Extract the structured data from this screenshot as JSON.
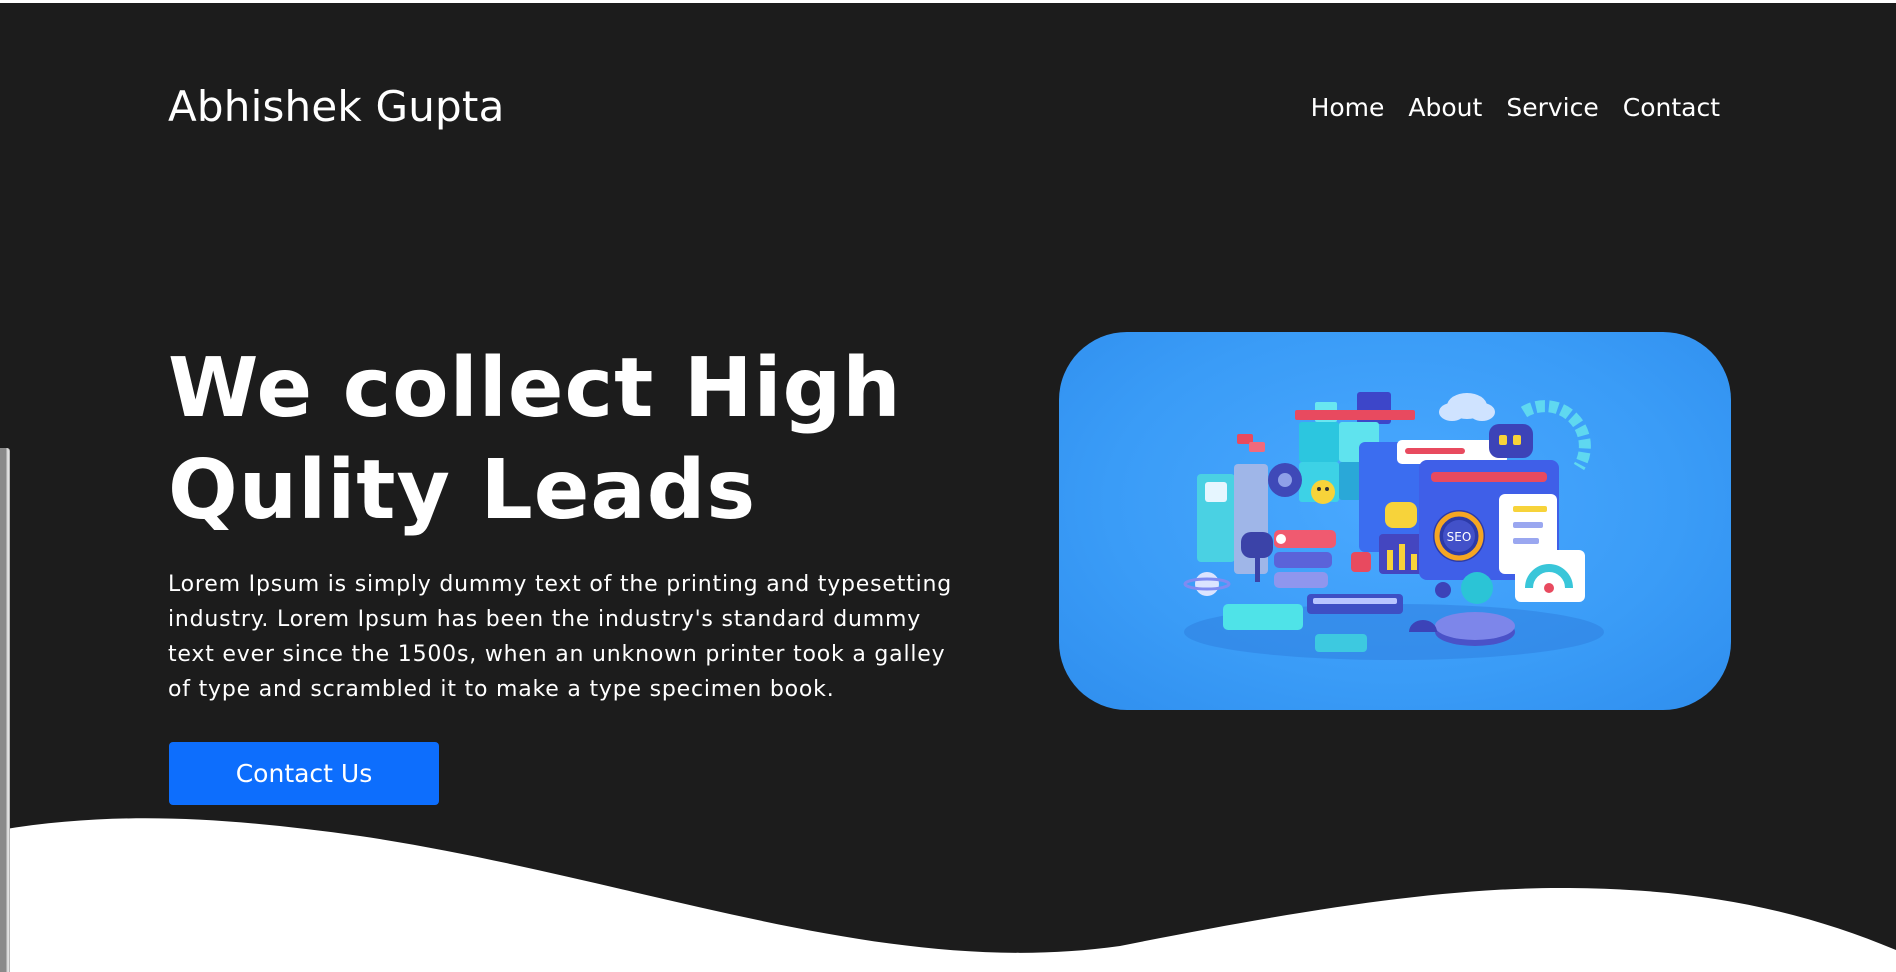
{
  "brand": {
    "name": "Abhishek Gupta"
  },
  "nav": {
    "items": [
      {
        "label": "Home"
      },
      {
        "label": "About"
      },
      {
        "label": "Service"
      },
      {
        "label": "Contact"
      }
    ]
  },
  "hero": {
    "title_line1": "We collect High",
    "title_line2": "Qulity Leads",
    "description": "Lorem Ipsum is simply dummy text of the printing and typesetting industry. Lorem Ipsum has been the industry's standard dummy text ever since the 1500s, when an unknown printer took a galley of type and scrambled it to make a type specimen book.",
    "cta_label": "Contact Us",
    "seo_badge": "SEO"
  },
  "colors": {
    "background": "#1c1c1c",
    "accent": "#0d6efd",
    "image_bg": "#3a9cf7",
    "wave": "#ffffff"
  }
}
